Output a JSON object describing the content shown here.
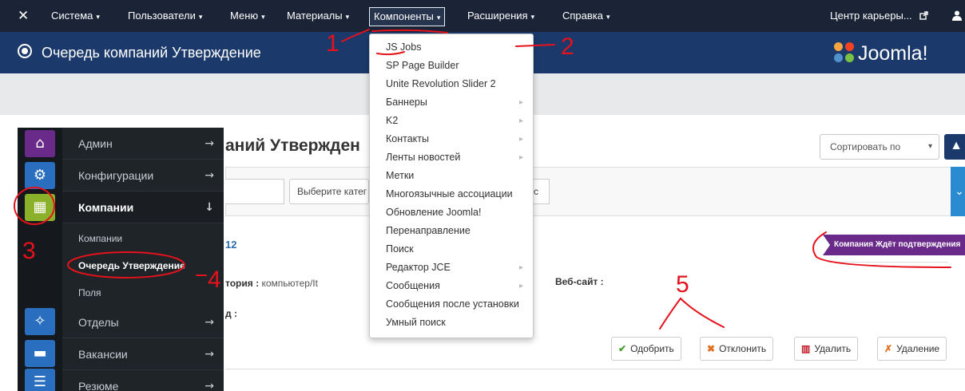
{
  "navbar": {
    "logo_glyph": "✕",
    "menu": [
      {
        "label": "Система"
      },
      {
        "label": "Пользователи"
      },
      {
        "label": "Меню"
      },
      {
        "label": "Материалы"
      },
      {
        "label": "Компоненты"
      },
      {
        "label": "Расширения"
      },
      {
        "label": "Справка"
      }
    ],
    "site_link": "Центр карьеры...",
    "site_link_icon": "external-link-icon",
    "user_icon": "user-icon",
    "caret": "▾"
  },
  "titlebar": {
    "title": "Очередь компаний Утверждение",
    "title_icon": "circle-dot-icon",
    "brand": "Joomla!"
  },
  "page": {
    "heading": "аний Утвержден",
    "sort_label": "Сортировать по",
    "sort_arrow": "▾",
    "sort_dir": "▲",
    "filter_category": "Выберите катег",
    "filter_status": "с",
    "filter_toggle": "⌄"
  },
  "company": {
    "id_text": "12",
    "status": "Компания Ждёт подтверждения",
    "category_label": "тория :",
    "category_value": "компьютер/It",
    "website_label": "Веб-сайт :",
    "address_label": "д :"
  },
  "actions": [
    {
      "label": "Одобрить",
      "icon": "✔",
      "icon_name": "check-icon",
      "color": "#4aa02c"
    },
    {
      "label": "Отклонить",
      "icon": "✖",
      "icon_name": "cross-icon",
      "color": "#e07020"
    },
    {
      "label": "Удалить",
      "icon": "▥",
      "icon_name": "trash-icon",
      "color": "#c0202a"
    },
    {
      "label": "Удаление",
      "icon": "✗",
      "icon_name": "file-delete-icon",
      "color": "#e07020"
    }
  ],
  "sidebar": {
    "items": [
      {
        "label": "Админ",
        "icon": "⌂",
        "icon_name": "home-icon",
        "icon_bg": "#6a2a8a",
        "arrow": "→"
      },
      {
        "label": "Конфигурации",
        "icon": "⚙",
        "icon_name": "gears-icon",
        "icon_bg": "#2a6fbf",
        "arrow": "→"
      },
      {
        "label": "Компании",
        "icon": "▦",
        "icon_name": "building-icon",
        "icon_bg": "#8bb02a",
        "arrow": "↓"
      },
      {
        "label": "Отделы",
        "icon": "✧",
        "icon_name": "network-icon",
        "icon_bg": "#2a6fbf",
        "arrow": "→"
      },
      {
        "label": "Вакансии",
        "icon": "▬",
        "icon_name": "briefcase-icon",
        "icon_bg": "#2a6fbf",
        "arrow": "→"
      },
      {
        "label": "Резюме",
        "icon": "☰",
        "icon_name": "resume-icon",
        "icon_bg": "#2a6fbf",
        "arrow": "→"
      }
    ],
    "subitems": [
      {
        "label": "Компании"
      },
      {
        "label": "Очередь Утверждение"
      },
      {
        "label": "Поля"
      }
    ]
  },
  "dropdown": {
    "items": [
      {
        "label": "JS Jobs",
        "has_sub": false
      },
      {
        "label": "SP Page Builder",
        "has_sub": false
      },
      {
        "label": "Unite Revolution Slider 2",
        "has_sub": false
      },
      {
        "label": "Баннеры",
        "has_sub": true
      },
      {
        "label": "K2",
        "has_sub": true
      },
      {
        "label": "Контакты",
        "has_sub": true
      },
      {
        "label": "Ленты новостей",
        "has_sub": true
      },
      {
        "label": "Метки",
        "has_sub": false
      },
      {
        "label": "Многоязычные ассоциации",
        "has_sub": false
      },
      {
        "label": "Обновление Joomla!",
        "has_sub": false
      },
      {
        "label": "Перенаправление",
        "has_sub": false
      },
      {
        "label": "Поиск",
        "has_sub": false
      },
      {
        "label": "Редактор JCE",
        "has_sub": true
      },
      {
        "label": "Сообщения",
        "has_sub": true
      },
      {
        "label": "Сообщения после установки",
        "has_sub": false
      },
      {
        "label": "Умный поиск",
        "has_sub": false
      }
    ],
    "sub_arrow": "▸"
  },
  "annotations": {
    "labels": [
      "1",
      "2",
      "3",
      "4",
      "5"
    ],
    "color": "#e5121b"
  },
  "colors": {
    "navbar": "#1a2436",
    "titlebar": "#1b3a6b",
    "sidebar": "#1f2429",
    "accent": "#2a8bd0",
    "badge": "#6a2a8a"
  }
}
